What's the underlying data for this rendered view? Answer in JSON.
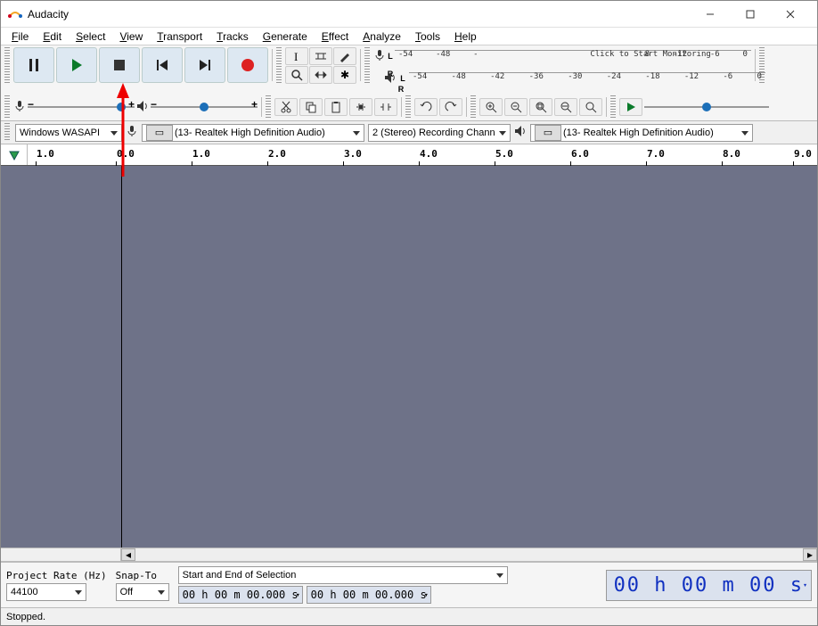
{
  "titlebar": {
    "title": "Audacity"
  },
  "menu": {
    "items": [
      "File",
      "Edit",
      "Select",
      "View",
      "Transport",
      "Tracks",
      "Generate",
      "Effect",
      "Analyze",
      "Tools",
      "Help"
    ]
  },
  "meters": {
    "ticks": [
      "-54",
      "-48",
      "-  ",
      "Click to Start Monitoring",
      "8",
      "-12",
      "-6",
      "0"
    ],
    "ticks2": [
      "-54",
      "-48",
      "-42",
      "-36",
      "-30",
      "-24",
      "-18",
      "-12",
      "-6",
      "0"
    ]
  },
  "deviceRow": {
    "host": "Windows WASAPI",
    "recDevice": "(13- Realtek High Definition Audio)",
    "recChannels": "2 (Stereo) Recording Chann",
    "playDevice": "(13- Realtek High Definition Audio)"
  },
  "ruler": {
    "ticks": [
      "1.0",
      "0.0",
      "1.0",
      "2.0",
      "3.0",
      "4.0",
      "5.0",
      "6.0",
      "7.0",
      "8.0",
      "9.0"
    ]
  },
  "bottom": {
    "projectRateLabel": "Project Rate (Hz)",
    "projectRate": "44100",
    "snapLabel": "Snap-To",
    "snap": "Off",
    "selLabel": "Start and End of Selection",
    "selStart": "00 h 00 m 00.000 s",
    "selEnd": "00 h 00 m 00.000 s",
    "position": "00 h 00 m 00 s"
  },
  "status": {
    "text": "Stopped."
  }
}
